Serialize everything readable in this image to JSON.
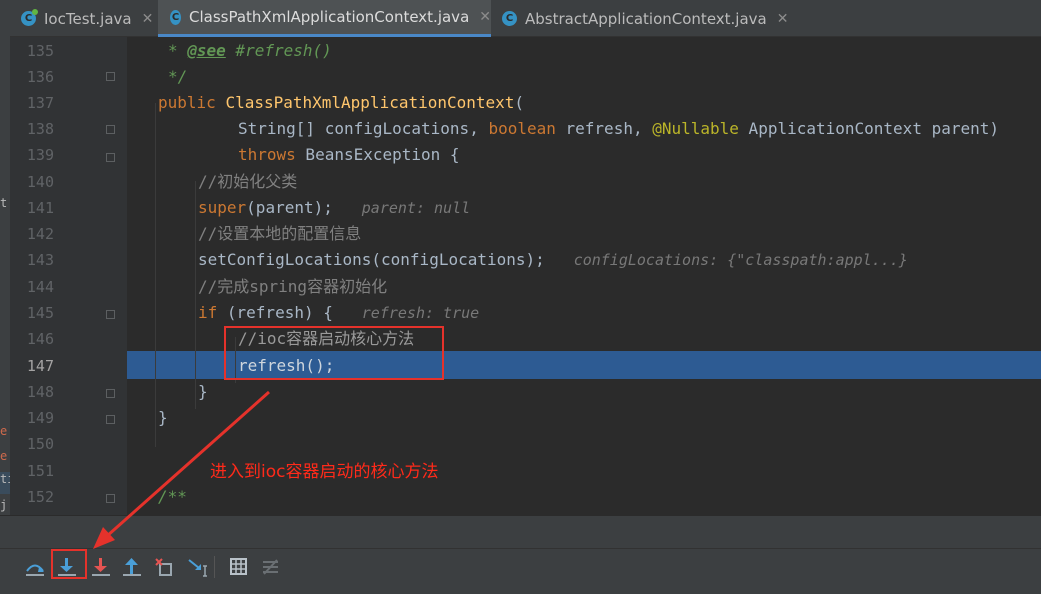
{
  "tabs": [
    {
      "label": "IocTest.java",
      "icon": "class-icon"
    },
    {
      "label": "ClassPathXmlApplicationContext.java",
      "icon": "class-icon",
      "active": true
    },
    {
      "label": "AbstractApplicationContext.java",
      "icon": "class-icon"
    }
  ],
  "left_strip_fragments": [
    "t",
    "e",
    "e",
    "ti",
    "j"
  ],
  "line_numbers": [
    "135",
    "136",
    "137",
    "138",
    "139",
    "140",
    "141",
    "142",
    "143",
    "144",
    "145",
    "146",
    "147",
    "148",
    "149",
    "150",
    "151",
    "152"
  ],
  "current_line": "147",
  "code": {
    "l135_star": "* ",
    "l135_tag": "@see",
    "l135_rest": " #refresh()",
    "l136": "*/",
    "l137_kw": "public ",
    "l137_fn": "ClassPathXmlApplicationContext",
    "l137_rest": "(",
    "l138_a": "String[] configLocations, ",
    "l138_kw": "boolean",
    "l138_b": " refresh, ",
    "l138_at": "@Nullable",
    "l138_c": " ApplicationContext parent)",
    "l139_kw": "throws",
    "l139_rest": " BeansException {",
    "l140": "//初始化父类",
    "l141_kw": "super",
    "l141_rest": "(parent);",
    "l141_hint": "parent: null",
    "l142": "//设置本地的配置信息",
    "l143": "setConfigLocations(configLocations);",
    "l143_hint": "configLocations: {\"classpath:appl...}",
    "l144": "//完成spring容器初始化",
    "l145_kw": "if",
    "l145_rest": " (refresh) {",
    "l145_hint": "refresh: true",
    "l146": "//ioc容器启动核心方法",
    "l147": "refresh();",
    "l148": "}",
    "l149": "}",
    "l152": "/**"
  },
  "annotation": "进入到ioc容器启动的核心方法",
  "toolbar": [
    "show-execution-point-icon",
    "step-over-icon",
    "step-into-icon",
    "force-step-into-icon",
    "step-out-icon",
    "drop-frame-icon",
    "run-to-cursor-icon",
    "evaluate-expression-icon",
    "trace-icon"
  ],
  "colors": {
    "accent": "#4a88c7",
    "highlight": "#2d5b93",
    "annotation": "#e5322b"
  }
}
